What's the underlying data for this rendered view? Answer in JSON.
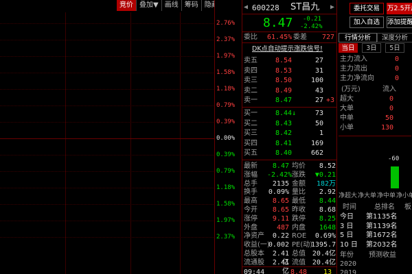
{
  "toolbar": {
    "items": [
      "竞价",
      "叠加▼",
      "画线",
      "筹码",
      "隐藏▼"
    ]
  },
  "chart": {
    "percents": [
      "2.76%",
      "2.37%",
      "1.97%",
      "1.58%",
      "1.18%",
      "0.79%",
      "0.39%",
      "0.00%",
      "0.39%",
      "0.79%",
      "1.18%",
      "1.58%",
      "1.97%",
      "2.37%"
    ]
  },
  "stock": {
    "code": "600228",
    "name": "ST昌九",
    "price": "8.47",
    "change": "-0.21",
    "change_pct": "-2.42%"
  },
  "ratio": {
    "wb_label": "委比",
    "wb_value": "61.45%",
    "wc_label": "委差",
    "wc_value": "727"
  },
  "banner": "DK点自动提示涨跌信号!",
  "sell": [
    {
      "label": "卖五",
      "price": "8.54",
      "vol": "27",
      "extra": ""
    },
    {
      "label": "卖四",
      "price": "8.53",
      "vol": "31",
      "extra": ""
    },
    {
      "label": "卖三",
      "price": "8.50",
      "vol": "100",
      "extra": ""
    },
    {
      "label": "卖二",
      "price": "8.49",
      "vol": "43",
      "extra": ""
    },
    {
      "label": "卖一",
      "price": "8.47",
      "vol": "27",
      "extra": "+3"
    }
  ],
  "buy": [
    {
      "label": "买一",
      "price": "8.44↓",
      "vol": "73"
    },
    {
      "label": "买二",
      "price": "8.43",
      "vol": "50"
    },
    {
      "label": "买三",
      "price": "8.42",
      "vol": "1"
    },
    {
      "label": "买四",
      "price": "8.41",
      "vol": "169"
    },
    {
      "label": "买五",
      "price": "8.40",
      "vol": "662"
    }
  ],
  "stats": [
    {
      "l1": "最新",
      "v1": "8.47",
      "c1": "green",
      "l2": "均价",
      "v2": "8.52",
      "c2": "white"
    },
    {
      "l1": "涨幅",
      "v1": "-2.42%",
      "c1": "green",
      "l2": "涨跌",
      "v2": "▼0.21",
      "c2": "green"
    },
    {
      "l1": "总手",
      "v1": "2135",
      "c1": "white",
      "l2": "金额",
      "v2": "182万",
      "c2": "cyan"
    },
    {
      "l1": "换手",
      "v1": "0.09%",
      "c1": "white",
      "l2": "量比",
      "v2": "2.92",
      "c2": "white"
    },
    {
      "l1": "最高",
      "v1": "8.65",
      "c1": "red",
      "l2": "最低",
      "v2": "8.44",
      "c2": "green"
    },
    {
      "l1": "今开",
      "v1": "8.65",
      "c1": "red",
      "l2": "昨收",
      "v2": "8.68",
      "c2": "white"
    },
    {
      "l1": "涨停",
      "v1": "9.11",
      "c1": "red",
      "l2": "跌停",
      "v2": "8.25",
      "c2": "green"
    },
    {
      "l1": "外盘",
      "v1": "487",
      "c1": "red",
      "l2": "内盘",
      "v2": "1648",
      "c2": "green"
    },
    {
      "l1": "净资产",
      "v1": "0.22",
      "c1": "white",
      "l2": "ROE",
      "v2": "0.69%",
      "c2": "white"
    },
    {
      "l1": "收益(一)",
      "v1": "0.002",
      "c1": "white",
      "l2": "PE(动)",
      "v2": "1395.7",
      "c2": "white"
    },
    {
      "l1": "总股本",
      "v1": "2.41亿",
      "c1": "white",
      "l2": "总值",
      "v2": "20.4亿",
      "c2": "white"
    },
    {
      "l1": "流通股",
      "v1": "2.41亿",
      "c1": "white",
      "l2": "流值",
      "v2": "20.4亿",
      "c2": "white"
    }
  ],
  "tick": {
    "time": "09:44",
    "price": "8.48",
    "vol": "13"
  },
  "right": {
    "btn_trade": "委托交易",
    "btn_promo": "万2.5开户",
    "btn_add": "加入自选",
    "btn_alert": "添加提醒",
    "tabs": [
      "行情分析",
      "深度分析"
    ],
    "subtabs": [
      "当日",
      "3日",
      "5日"
    ],
    "flow": [
      {
        "label": "主力流入",
        "value": "0"
      },
      {
        "label": "主力流出",
        "value": "0"
      },
      {
        "label": "主力净流向",
        "value": "0"
      }
    ],
    "unit": "(万元)",
    "in_header": "流入",
    "sizes": [
      {
        "label": "超大",
        "value": "0"
      },
      {
        "label": "大单",
        "value": "0"
      },
      {
        "label": "中单",
        "value": "50"
      },
      {
        "label": "小单",
        "value": "130"
      }
    ],
    "bar_value": "-60",
    "bar_fraction": 0.75,
    "bar_labels": [
      "净超大",
      "净大单",
      "净中单",
      "净小单"
    ],
    "rank_headers": [
      "时间",
      "总排名",
      "板"
    ],
    "ranks": [
      {
        "t": "今日",
        "r": "第1135名"
      },
      {
        "t": "3 日",
        "r": "第1139名"
      },
      {
        "t": "5 日",
        "r": "第1672名"
      },
      {
        "t": "10 日",
        "r": "第2032名"
      }
    ],
    "footer_headers": [
      "年份",
      "预测收益"
    ],
    "footer_years": [
      "2020",
      "2019"
    ]
  }
}
